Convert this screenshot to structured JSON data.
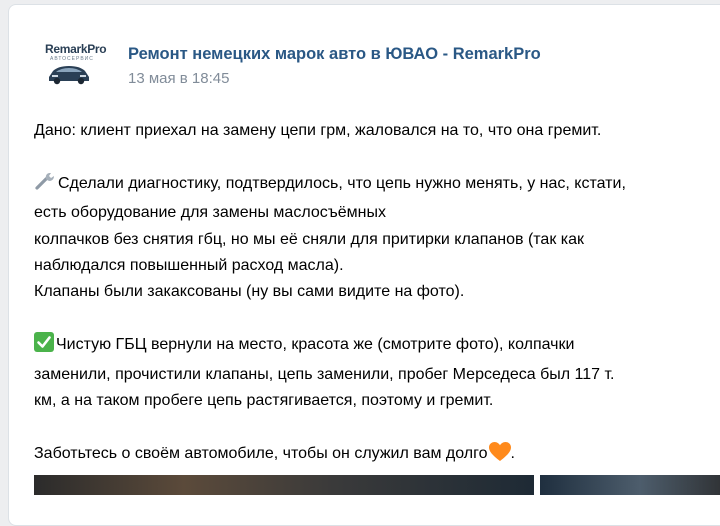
{
  "post": {
    "author": "Ремонт немецких марок авто в ЮВАО - RemarkPro",
    "date": "13 мая в 18:45",
    "logo_text": "RemarkPro",
    "logo_subtext": "АВТОСЕРВИС",
    "lines": {
      "l1": "Дано: клиент приехал на замену цепи грм, жаловался на то, что она гремит.",
      "l2": "Сделали диагностику, подтвердилось, что цепь нужно менять, у нас, кстати,",
      "l3": "есть оборудование для замены маслосъёмных",
      "l4": "колпачков без снятия гбц, но мы её сняли для притирки клапанов (так как",
      "l5": "наблюдался повышенный расход масла).",
      "l6": "Клапаны были закаксованы (ну вы сами видите на фото).",
      "l7": "Чистую ГБЦ вернули на место, красота же (смотрите фото), колпачки",
      "l8": "заменили, прочистили клапаны, цепь заменили, пробег Мерседеса был 117 т.",
      "l9": "км, а на таком пробеге цепь растягивается, поэтому и гремит.",
      "l10": "Заботьтесь о своём автомобиле, чтобы он служил вам долго",
      "l10_end": "."
    },
    "icons": {
      "wrench": "wrench-emoji",
      "check": "check-mark-button-emoji",
      "heart": "orange-heart-emoji"
    }
  },
  "colors": {
    "author_link": "#2a5885",
    "date": "#818c99",
    "page_bg": "#edeef0",
    "check_green": "#4bb34b",
    "heart_orange": "#ff8a1c"
  }
}
